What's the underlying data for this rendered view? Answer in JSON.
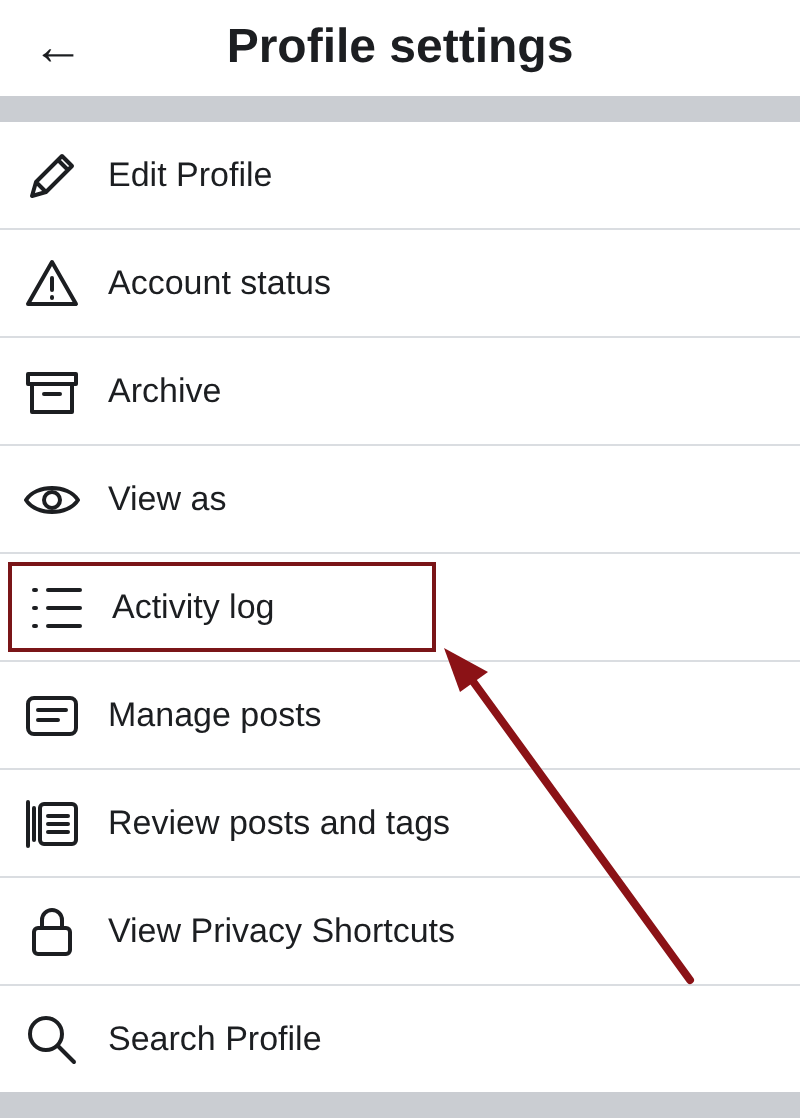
{
  "header": {
    "back_icon": "←",
    "title": "Profile settings"
  },
  "items": [
    {
      "label": "Edit Profile",
      "kind": "pencil",
      "highlighted": false
    },
    {
      "label": "Account status",
      "kind": "warning",
      "highlighted": false
    },
    {
      "label": "Archive",
      "kind": "archive",
      "highlighted": false
    },
    {
      "label": "View as",
      "kind": "eye",
      "highlighted": false
    },
    {
      "label": "Activity log",
      "kind": "list",
      "highlighted": true
    },
    {
      "label": "Manage posts",
      "kind": "posts",
      "highlighted": false
    },
    {
      "label": "Review posts and tags",
      "kind": "review",
      "highlighted": false
    },
    {
      "label": "View Privacy Shortcuts",
      "kind": "lock",
      "highlighted": false
    },
    {
      "label": "Search Profile",
      "kind": "search",
      "highlighted": false
    }
  ]
}
